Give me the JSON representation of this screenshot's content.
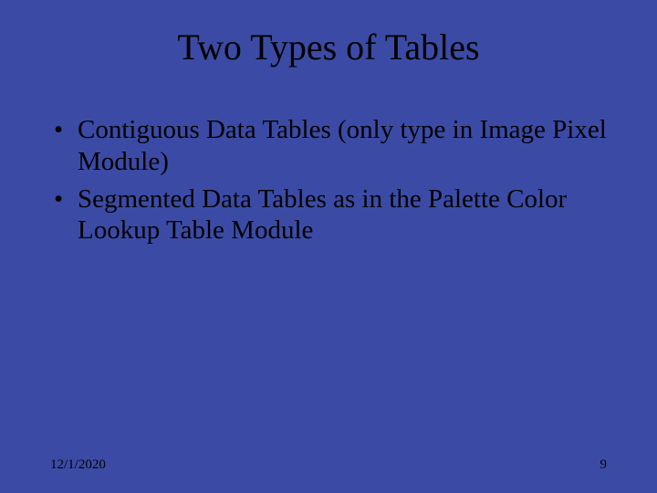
{
  "slide": {
    "title": "Two Types of  Tables",
    "bullets": [
      "Contiguous Data Tables (only type in Image Pixel Module)",
      "Segmented Data Tables as in the Palette Color Lookup Table Module"
    ],
    "footer": {
      "date": "12/1/2020",
      "page_number": "9"
    }
  }
}
